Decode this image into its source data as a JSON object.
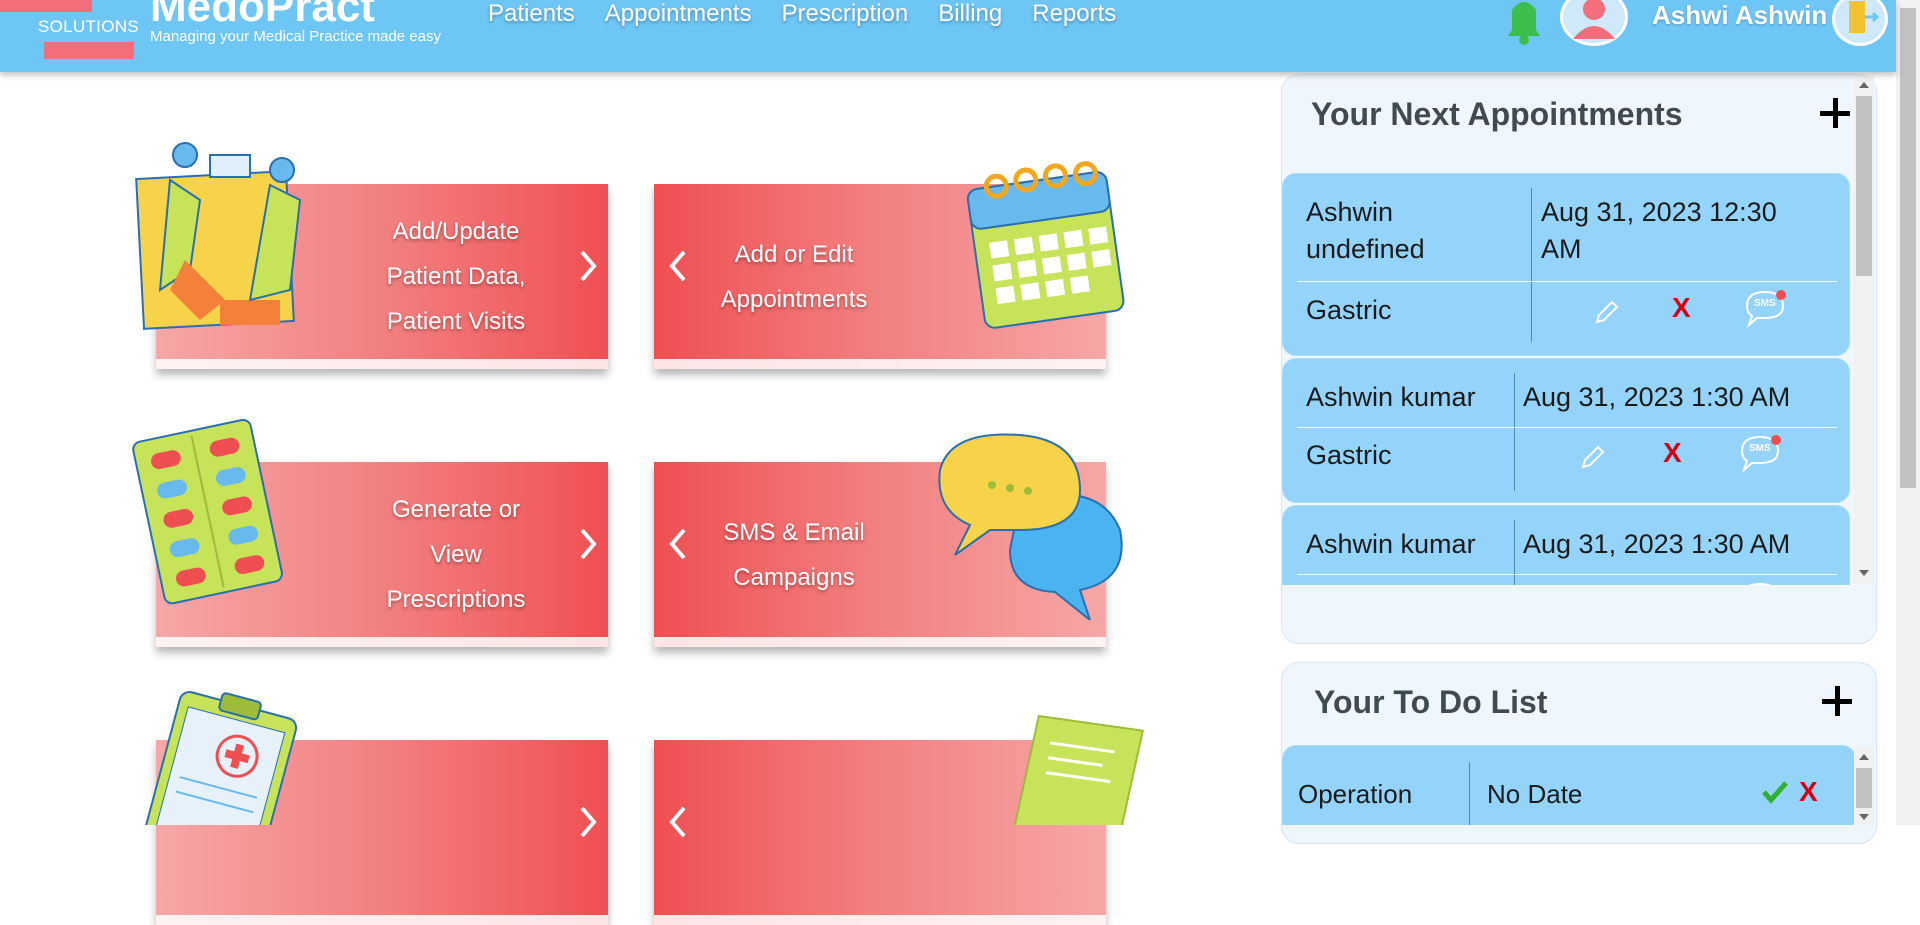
{
  "header": {
    "logo_sub": "SOLUTIONS",
    "brand_name": "MedoPract",
    "brand_tagline": "Managing your Medical Practice made easy",
    "nav": [
      "Patients",
      "Appointments",
      "Prescription",
      "Billing",
      "Reports"
    ],
    "user_name": "Ashwi  Ashwin"
  },
  "tiles": [
    {
      "label": "Add/Update\nPatient Data,\nPatient Visits",
      "illustration": "doctor-patient-consultation"
    },
    {
      "label": "Add or Edit\nAppointments",
      "illustration": "calendar"
    },
    {
      "label": "Generate or\nView\nPrescriptions",
      "illustration": "pill-blister-pack"
    },
    {
      "label": "SMS & Email\nCampaigns",
      "illustration": "chat-bubbles"
    },
    {
      "label": "",
      "illustration": "medical-clipboard"
    },
    {
      "label": "",
      "illustration": "document-receipt"
    }
  ],
  "appointments": {
    "title": "Your Next Appointments",
    "items": [
      {
        "name": "Ashwin\nundefined",
        "datetime": "Aug 31, 2023 12:30\nAM",
        "reason": "Gastric",
        "sms_label": "SMS"
      },
      {
        "name": "Ashwin kumar",
        "datetime": "Aug 31, 2023 1:30 AM",
        "reason": "Gastric",
        "sms_label": "SMS"
      },
      {
        "name": "Ashwin kumar",
        "datetime": "Aug 31, 2023 1:30 AM",
        "reason": "",
        "sms_label": "SMS"
      }
    ],
    "delete_label": "X"
  },
  "todo": {
    "title": "Your To Do List",
    "items": [
      {
        "task": "Operation",
        "date": "No Date"
      }
    ],
    "delete_label": "X"
  },
  "colors": {
    "header": "#6ec6f5",
    "tile_red": "#f04f52",
    "card_blue": "#94d3fa",
    "delete_red": "#d90010",
    "done_green": "#2fb12f"
  }
}
